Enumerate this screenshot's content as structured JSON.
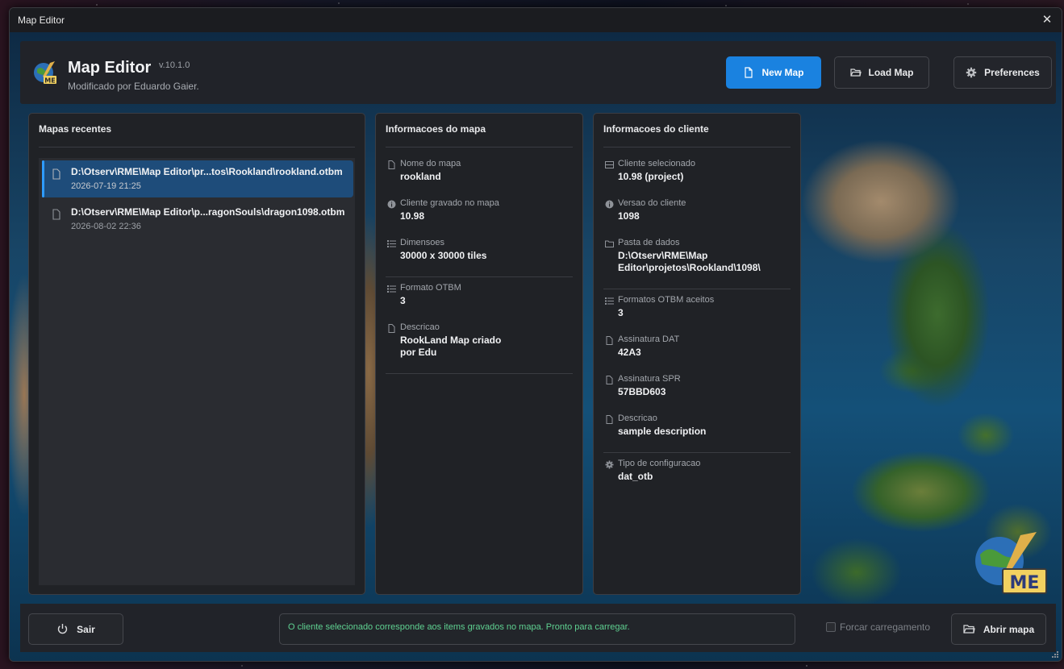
{
  "window": {
    "title": "Map Editor"
  },
  "header": {
    "title": "Map Editor",
    "version": "v.10.1.0",
    "subtitle": "Modificado por Eduardo Gaier.",
    "buttons": {
      "new_map": "New Map",
      "load_map": "Load Map",
      "preferences": "Preferences"
    }
  },
  "recent_maps": {
    "title": "Mapas recentes",
    "items": [
      {
        "path": "D:\\Otserv\\RME\\Map Editor\\pr...tos\\Rookland\\rookland.otbm",
        "date": "2026-07-19 21:25",
        "selected": true
      },
      {
        "path": "D:\\Otserv\\RME\\Map Editor\\p...ragonSouls\\dragon1098.otbm",
        "date": "2026-08-02 22:36",
        "selected": false
      }
    ]
  },
  "map_info": {
    "title": "Informacoes do mapa",
    "fields": [
      {
        "icon": "file-icon",
        "label": "Nome do mapa",
        "value": "rookland"
      },
      {
        "icon": "info-icon",
        "label": "Cliente gravado no mapa",
        "value": "10.98"
      },
      {
        "icon": "list-icon",
        "label": "Dimensoes",
        "value": "30000 x 30000 tiles"
      },
      {
        "icon": "list-icon",
        "label": "Formato OTBM",
        "value": "3"
      },
      {
        "icon": "file-icon",
        "label": "Descricao",
        "value": "RookLand Map criado por Edu"
      }
    ]
  },
  "client_info": {
    "title": "Informacoes do cliente",
    "fields": [
      {
        "icon": "monitor-icon",
        "label": "Cliente selecionado",
        "value": "10.98 (project)"
      },
      {
        "icon": "info-icon",
        "label": "Versao do cliente",
        "value": "1098"
      },
      {
        "icon": "folder-icon",
        "label": "Pasta de dados",
        "value": "D:\\Otserv\\RME\\Map Editor\\projetos\\Rookland\\1098\\"
      },
      {
        "icon": "list-icon",
        "label": "Formatos OTBM aceitos",
        "value": "3"
      },
      {
        "icon": "file-icon",
        "label": "Assinatura DAT",
        "value": "42A3"
      },
      {
        "icon": "file-icon",
        "label": "Assinatura SPR",
        "value": "57BBD603"
      },
      {
        "icon": "file-icon",
        "label": "Descricao",
        "value": "sample description"
      },
      {
        "icon": "gear-icon",
        "label": "Tipo de configuracao",
        "value": "dat_otb"
      }
    ]
  },
  "footer": {
    "exit_label": "Sair",
    "status": "O cliente selecionado corresponde aos items gravados no mapa. Pronto para carregar.",
    "force_load_label": "Forcar carregamento",
    "force_load_checked": false,
    "open_label": "Abrir mapa"
  },
  "colors": {
    "accent": "#1a82e0",
    "status_ok": "#5fd191",
    "selected_row": "#1e4c7a"
  }
}
